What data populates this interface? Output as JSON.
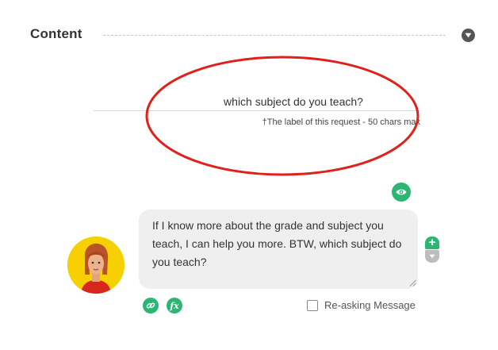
{
  "section": {
    "title": "Content",
    "collapse_icon": "chevron-down-icon"
  },
  "label_field": {
    "value": "which subject do you teach?",
    "hint": "†The label of this request - 50 chars max"
  },
  "message": {
    "text": "If I know more about the grade and subject you teach, I can help you more. BTW, which subject do you teach?",
    "preview_icon": "eye-icon",
    "add_icon": "plus-icon",
    "move_down_icon": "chevron-down-icon"
  },
  "footer": {
    "link_icon": "link-icon",
    "function_icon": "function-icon",
    "function_glyph": "fx",
    "reasking_label": "Re-asking Message",
    "reasking_checked": false
  },
  "colors": {
    "accent_green": "#2bb673",
    "highlight_red": "#e0201b",
    "avatar_bg": "#f6d000"
  }
}
